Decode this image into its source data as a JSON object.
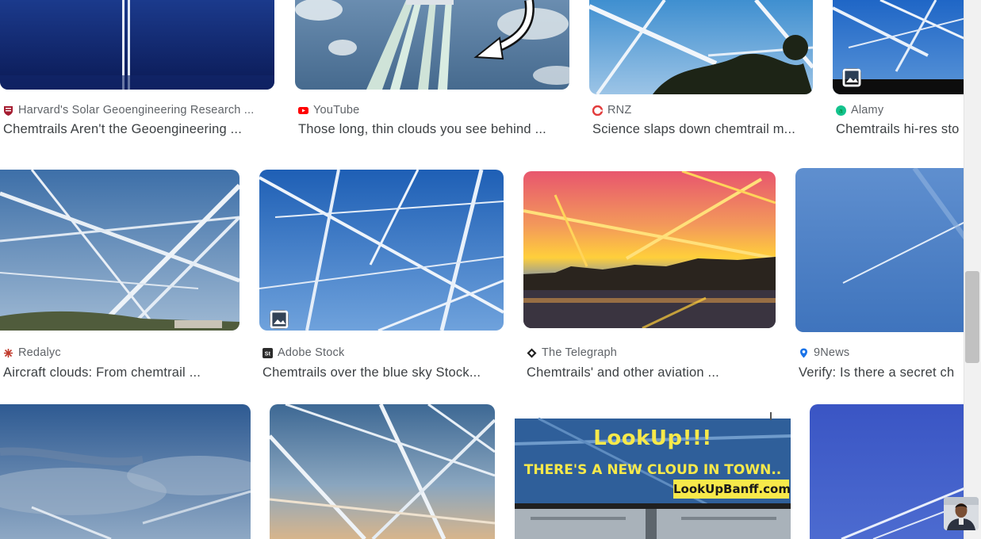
{
  "results": [
    {
      "source": "Harvard's Solar Geoengineering Research ...",
      "title": "Chemtrails Aren't the Geoengineering ...",
      "favicon": "harvard-shield-icon"
    },
    {
      "source": "YouTube",
      "title": "Those long, thin clouds you see behind ...",
      "favicon": "youtube-icon"
    },
    {
      "source": "RNZ",
      "title": "Science slaps down chemtrail m...",
      "favicon": "rnz-icon"
    },
    {
      "source": "Alamy",
      "title": "Chemtrails hi-res sto",
      "favicon": "alamy-icon"
    },
    {
      "source": "Redalyc",
      "title": "Aircraft clouds: From chemtrail ...",
      "favicon": "redalyc-icon"
    },
    {
      "source": "Adobe Stock",
      "title": "Chemtrails over the blue sky Stock...",
      "favicon": "adobe-stock-icon"
    },
    {
      "source": "The Telegraph",
      "title": "Chemtrails' and other aviation ...",
      "favicon": "telegraph-icon"
    },
    {
      "source": "9News",
      "title": "Verify: Is there a secret ch",
      "favicon": "map-pin-icon"
    }
  ],
  "billboard": {
    "line1": "LookUp!!!",
    "line2": "THERE'S A NEW CLOUD IN TOWN..",
    "line3": "LookUpBanff.com"
  },
  "colors": {
    "sky_blue": "#3f7fc4",
    "youtube_red": "#ff0000",
    "rnz_red": "#e23b3b",
    "alamy_green": "#14c38e",
    "ninenews_blue": "#1a73e8"
  }
}
